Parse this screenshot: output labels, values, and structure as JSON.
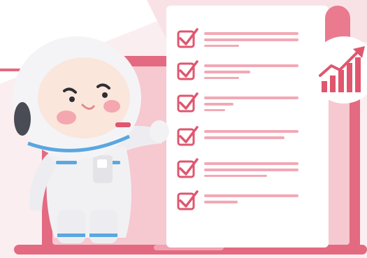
{
  "illustration": {
    "colors": {
      "accent": "#e0566e",
      "accent_light": "#f2a9b5",
      "pink_bg": "#f7d9de",
      "laptop_frame": "#e36a80",
      "paper": "#ffffff",
      "astronaut_suit": "#f1f1f4",
      "astronaut_trim": "#5aa7e0"
    },
    "icons": [
      "checkbox-check-icon",
      "growth-chart-icon",
      "astronaut-mascot"
    ],
    "checklist_item_count": 6
  }
}
